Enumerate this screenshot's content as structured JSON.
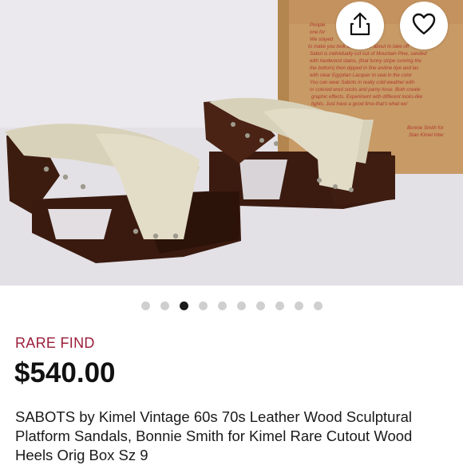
{
  "listing": {
    "badge": "RARE FIND",
    "price": "$540.00",
    "title": "SABOTS by Kimel Vintage 60s 70s Leather Wood Sculptural Platform Sandals, Bonnie Smith for Kimel Rare Cutout Wood Heels Orig Box Sz 9"
  },
  "gallery": {
    "image_count": 10,
    "active_index": 3,
    "box_text": [
      "People",
      "one for",
      "We stayed",
      "to make you look like you are about to take off",
      "Sabot is individually cut out of Mountain Pine, sanded",
      "with hardwood stains, (that funny stripe running the",
      "the bottom) then dipped in fine aniline dye and lac",
      "with clear Egyptian Lacquer to seal in the color",
      "You can wear Sabots in really cold weather with",
      "or colored wool socks and panty hose. Both create",
      "graphic effects. Experiment with different looks-like",
      "tights. Just have a good time-that's what we'",
      "Bonnie Smith for",
      "Stan Kimel Inter"
    ]
  },
  "icons": {
    "share": "share-icon",
    "like": "heart-icon"
  },
  "colors": {
    "badge": "#9b1f3a",
    "price": "#111111",
    "dot_active": "#1a1a1a",
    "dot_inactive": "#cfcfcf",
    "box": "#c79a66",
    "box_text": "#b23a2e",
    "wood": "#3e1d12",
    "leather": "#ddd6c0"
  }
}
